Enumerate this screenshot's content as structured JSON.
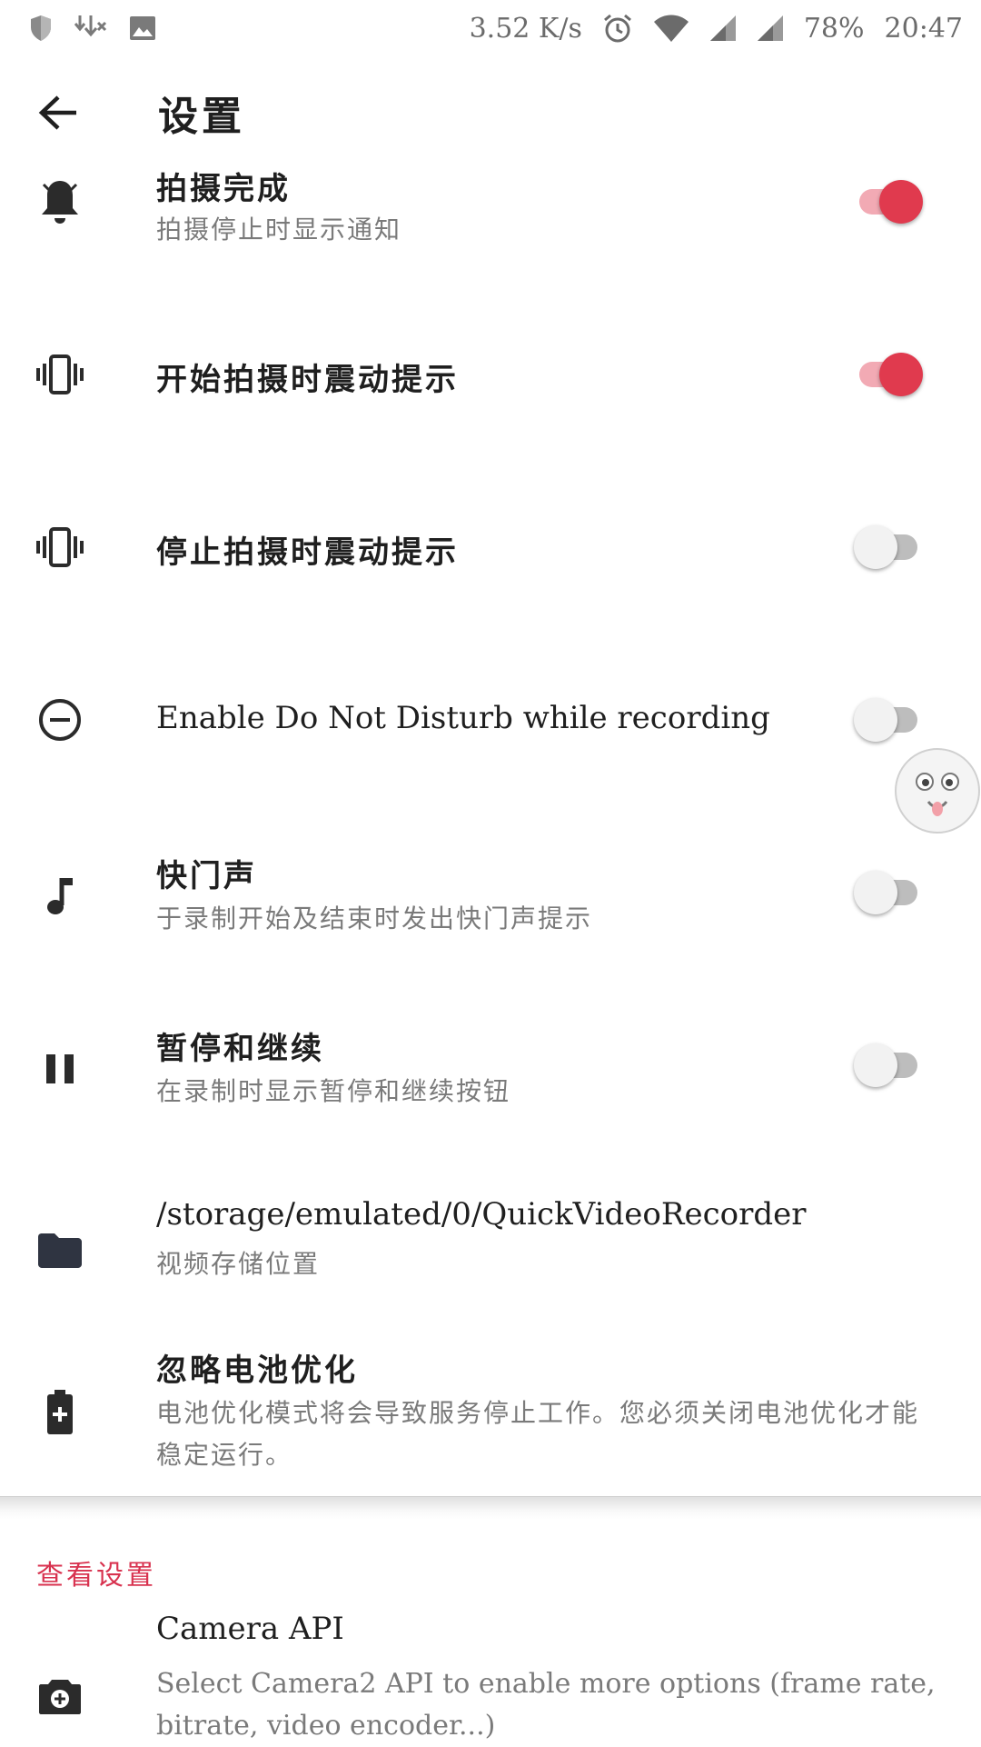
{
  "status_bar": {
    "net_speed": "3.52 K/s",
    "battery": "78%",
    "time": "20:47",
    "icons_left": [
      "shield-icon",
      "download-icon",
      "image-icon"
    ],
    "icons_right": [
      "alarm-icon",
      "wifi-icon",
      "signal-icon",
      "signal-icon"
    ]
  },
  "appbar": {
    "title": "设置",
    "back_icon": "arrow-back-icon"
  },
  "settings": [
    {
      "title": "拍摄完成",
      "subtitle": "拍摄停止时显示通知",
      "icon": "bell-icon",
      "toggle": true
    },
    {
      "title": "开始拍摄时震动提示",
      "icon": "vibrate-icon",
      "toggle": true
    },
    {
      "title": "停止拍摄时震动提示",
      "icon": "vibrate-icon",
      "toggle": false
    },
    {
      "title": "Enable Do Not Disturb while recording",
      "icon": "do-not-disturb-icon",
      "toggle": false
    },
    {
      "title": "快门声",
      "subtitle": "于录制开始及结束时发出快门声提示",
      "icon": "music-note-icon",
      "toggle": false
    },
    {
      "title": "暂停和继续",
      "subtitle": "在录制时显示暂停和继续按钮",
      "icon": "pause-icon",
      "toggle": false
    },
    {
      "title": "/storage/emulated/0/QuickVideoRecorder",
      "subtitle": "视频存储位置",
      "icon": "folder-icon"
    },
    {
      "title": "忽略电池优化",
      "subtitle": "电池优化模式将会导致服务停止工作。您必须关闭电池优化才能稳定运行。",
      "icon": "battery-plus-icon"
    }
  ],
  "view_section": {
    "header": "查看设置",
    "items": [
      {
        "title": "Camera API",
        "subtitle": "Select Camera2 API to enable more options (frame rate, bitrate, video encoder...)",
        "icon": "camera-icon"
      }
    ]
  },
  "colors": {
    "accent": "#e03a4e",
    "accent_track": "#f2aab4",
    "section_header": "#d8324f",
    "icon": "#2b2b2b"
  }
}
